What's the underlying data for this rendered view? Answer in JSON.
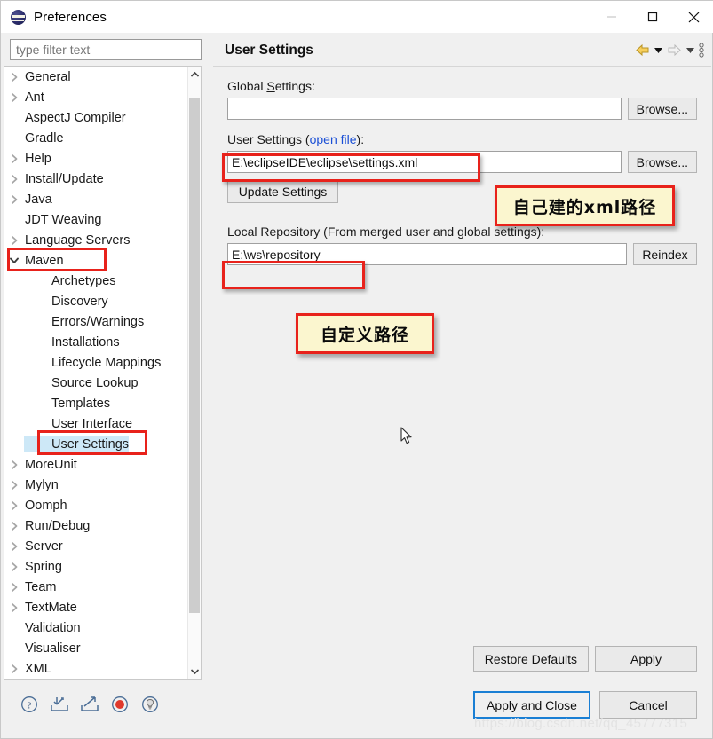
{
  "window": {
    "title": "Preferences",
    "icon": "eclipse-icon",
    "minimize_label": "—",
    "maximize_label": "□",
    "close_label": "✕"
  },
  "filter": {
    "placeholder": "type filter text",
    "value": ""
  },
  "tree": {
    "items": [
      {
        "label": "General",
        "expander": "collapsed",
        "level": 0
      },
      {
        "label": "Ant",
        "expander": "collapsed",
        "level": 0
      },
      {
        "label": "AspectJ Compiler",
        "expander": "none",
        "level": 0
      },
      {
        "label": "Gradle",
        "expander": "none",
        "level": 0
      },
      {
        "label": "Help",
        "expander": "collapsed",
        "level": 0
      },
      {
        "label": "Install/Update",
        "expander": "collapsed",
        "level": 0
      },
      {
        "label": "Java",
        "expander": "collapsed",
        "level": 0
      },
      {
        "label": "JDT Weaving",
        "expander": "none",
        "level": 0
      },
      {
        "label": "Language Servers",
        "expander": "collapsed",
        "level": 0
      },
      {
        "label": "Maven",
        "expander": "expanded",
        "level": 0,
        "highlight": true
      },
      {
        "label": "Archetypes",
        "expander": "none",
        "level": 1
      },
      {
        "label": "Discovery",
        "expander": "none",
        "level": 1
      },
      {
        "label": "Errors/Warnings",
        "expander": "none",
        "level": 1
      },
      {
        "label": "Installations",
        "expander": "none",
        "level": 1
      },
      {
        "label": "Lifecycle Mappings",
        "expander": "none",
        "level": 1
      },
      {
        "label": "Source Lookup",
        "expander": "none",
        "level": 1
      },
      {
        "label": "Templates",
        "expander": "none",
        "level": 1
      },
      {
        "label": "User Interface",
        "expander": "none",
        "level": 1
      },
      {
        "label": "User Settings",
        "expander": "none",
        "level": 1,
        "selected": true,
        "highlight": true
      },
      {
        "label": "MoreUnit",
        "expander": "collapsed",
        "level": 0
      },
      {
        "label": "Mylyn",
        "expander": "collapsed",
        "level": 0
      },
      {
        "label": "Oomph",
        "expander": "collapsed",
        "level": 0
      },
      {
        "label": "Run/Debug",
        "expander": "collapsed",
        "level": 0
      },
      {
        "label": "Server",
        "expander": "collapsed",
        "level": 0
      },
      {
        "label": "Spring",
        "expander": "collapsed",
        "level": 0
      },
      {
        "label": "Team",
        "expander": "collapsed",
        "level": 0
      },
      {
        "label": "TextMate",
        "expander": "collapsed",
        "level": 0
      },
      {
        "label": "Validation",
        "expander": "none",
        "level": 0
      },
      {
        "label": "Visualiser",
        "expander": "none",
        "level": 0
      },
      {
        "label": "XML",
        "expander": "collapsed",
        "level": 0
      }
    ]
  },
  "pane": {
    "title": "User Settings",
    "toolbar": {
      "back": "back-arrow-icon",
      "back_menu": "chevron-down-icon",
      "forward": "forward-arrow-icon",
      "forward_menu": "chevron-down-icon",
      "overflow": "vertical-dots-icon"
    },
    "global_settings": {
      "label": "Global Settings:",
      "value": "",
      "browse_label": "Browse..."
    },
    "user_settings": {
      "label_prefix": "User Settings (",
      "link": "open file",
      "label_suffix": "):",
      "value": "E:\\eclipseIDE\\eclipse\\settings.xml",
      "browse_label": "Browse...",
      "update_label": "Update Settings"
    },
    "local_repository": {
      "label": "Local Repository (From merged user and global settings):",
      "value": "E:\\ws\\repository",
      "reindex_label": "Reindex"
    },
    "restore_defaults_label": "Restore Defaults",
    "apply_label": "Apply"
  },
  "annotations": [
    {
      "text": "自己建的xml路径"
    },
    {
      "text": "自定义路径"
    }
  ],
  "footer": {
    "icons": [
      "help-icon",
      "import-icon",
      "export-icon",
      "record-icon",
      "tip-lightbulb-icon"
    ],
    "apply_and_close_label": "Apply and Close",
    "cancel_label": "Cancel"
  },
  "watermark": "https://blog.csdn.net/qq_45777315",
  "colors": {
    "annotation_border": "#e8221b",
    "annotation_fill": "#fbf6cf",
    "selection": "#cde8f7",
    "link": "#1a4fd6",
    "primary_button_border": "#1a7fd4"
  }
}
